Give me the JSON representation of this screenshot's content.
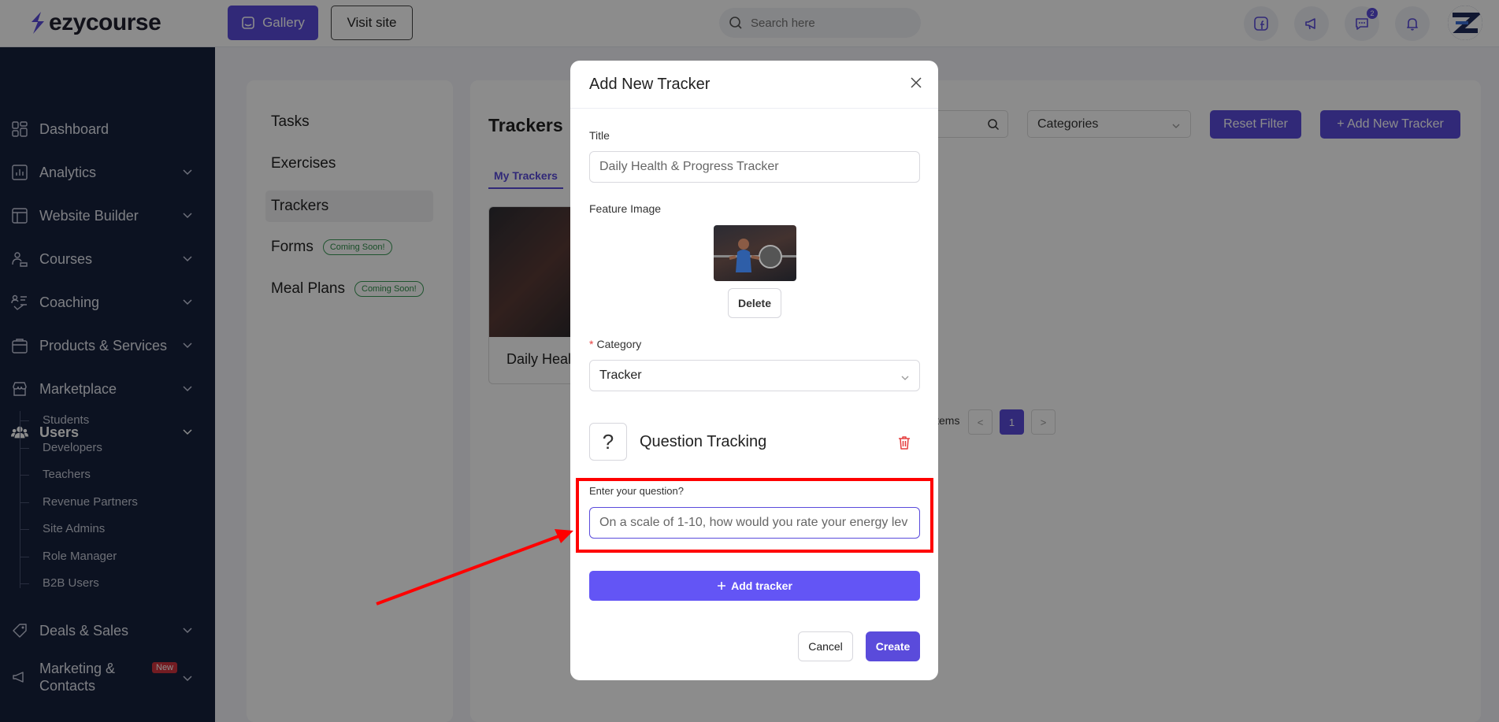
{
  "app": {
    "logo": "ezycourse"
  },
  "topbar": {
    "gallery_label": "Gallery",
    "visit_label": "Visit site",
    "search_placeholder": "Search here",
    "messages_badge": "2"
  },
  "sidebar": {
    "items": [
      {
        "label": "Dashboard",
        "icon": "dashboard-icon"
      },
      {
        "label": "Analytics",
        "icon": "analytics-icon"
      },
      {
        "label": "Website Builder",
        "icon": "website-builder-icon"
      },
      {
        "label": "Courses",
        "icon": "courses-icon"
      },
      {
        "label": "Coaching",
        "icon": "coaching-icon"
      },
      {
        "label": "Products & Services",
        "icon": "products-icon"
      },
      {
        "label": "Marketplace",
        "icon": "marketplace-icon"
      },
      {
        "label": "Users",
        "icon": "users-icon"
      }
    ],
    "users_sub": [
      "Students",
      "Developers",
      "Teachers",
      "Revenue Partners",
      "Site Admins",
      "Role Manager",
      "B2B Users"
    ],
    "deals_label": "Deals & Sales",
    "marketing_label": "Marketing &",
    "marketing_label2": "Contacts",
    "new_badge": "New"
  },
  "left_menu": {
    "tasks": "Tasks",
    "exercises": "Exercises",
    "trackers": "Trackers",
    "forms": "Forms",
    "meal_plans": "Meal Plans",
    "coming_soon": "Coming Soon!"
  },
  "main": {
    "title": "Trackers",
    "tab_my": "My Trackers",
    "categories_placeholder": "Categories",
    "reset_filter": "Reset Filter",
    "add_new": "+ Add New Tracker",
    "card_title": "Daily Heal",
    "items_text": "items",
    "page": "1",
    "prev": "<",
    "next": ">"
  },
  "modal": {
    "title": "Add New Tracker",
    "title_label": "Title",
    "title_value": "Daily Health & Progress Tracker",
    "feature_image_label": "Feature Image",
    "delete_label": "Delete",
    "category_label": "Category",
    "category_value": "Tracker",
    "question_icon": "?",
    "question_tracking": "Question Tracking",
    "question_label": "Enter your question?",
    "question_value": "On a scale of 1-10, how would you rate your energy lev",
    "add_tracker": "Add tracker",
    "cancel": "Cancel",
    "create": "Create"
  },
  "colors": {
    "accent": "#5a4bdb",
    "sidebar": "#16213d",
    "annotation": "#ff0000"
  }
}
